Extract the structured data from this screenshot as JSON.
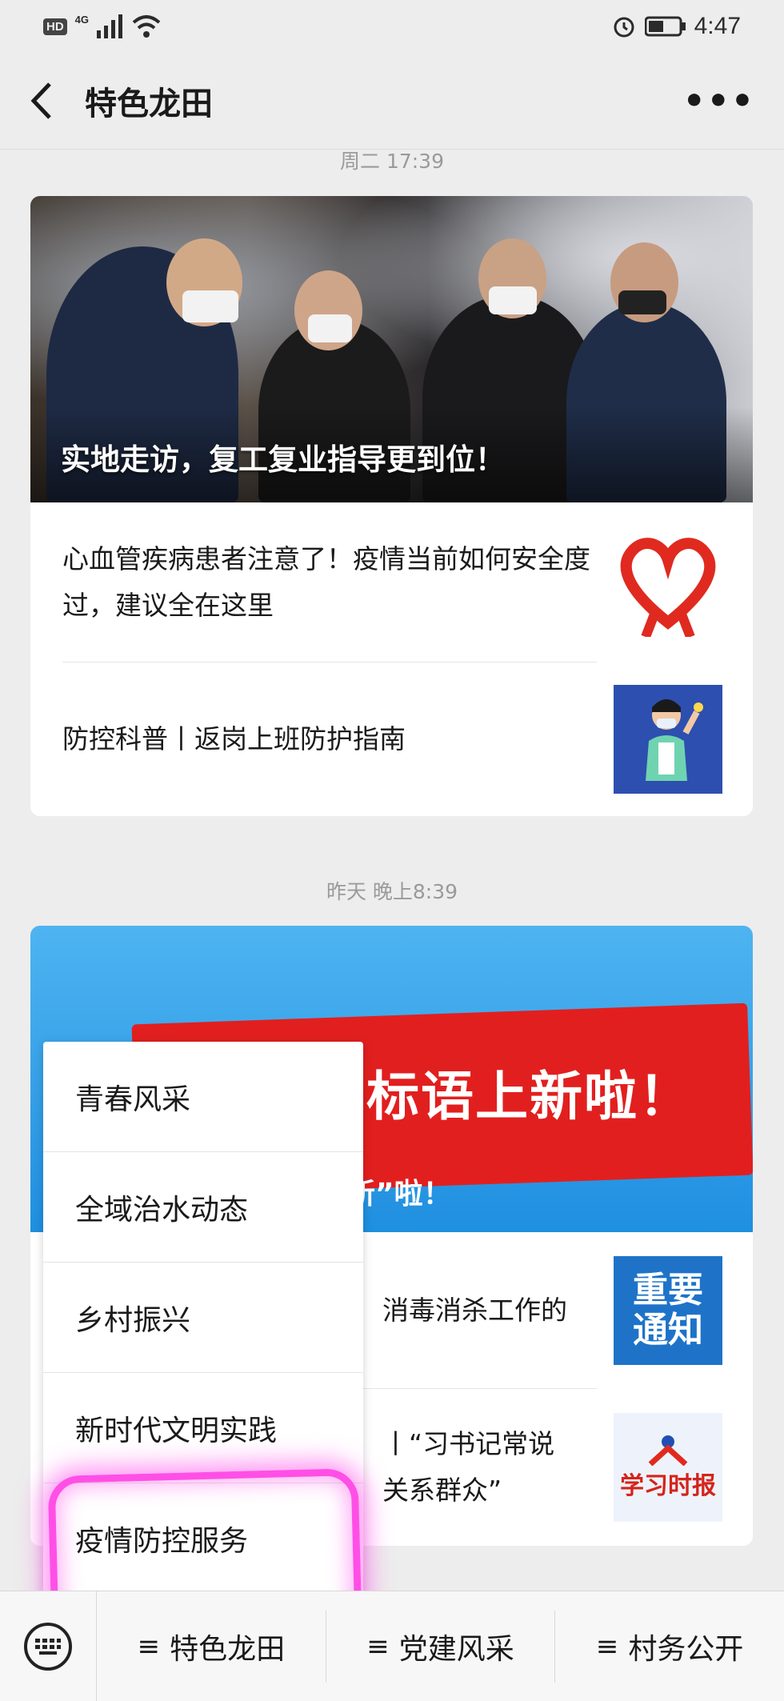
{
  "status_bar": {
    "hd_badge": "HD",
    "network": "4G",
    "time": "4:47"
  },
  "nav": {
    "title": "特色龙田",
    "more_glyph": "•••"
  },
  "feed": [
    {
      "timestamp": "周二 17:39",
      "hero_caption": "实地走访，复工复业指导更到位！",
      "articles": [
        {
          "title": "心血管疾病患者注意了！疫情当前如何安全度过，建议全在这里"
        },
        {
          "title": "防控科普丨返岗上班防护指南"
        }
      ]
    },
    {
      "timestamp": "昨天 晚上8:39",
      "banner_text": "标语上新啦！",
      "banner_caption": "新”啦！",
      "articles": [
        {
          "title": "消毒消杀工作的"
        },
        {
          "title": "丨“习书记常说",
          "title_line2": "关系群众”"
        }
      ],
      "thumb_notice": [
        "重要",
        "通知"
      ],
      "thumb_paper": "学习时报"
    }
  ],
  "popup_menu": {
    "items": [
      "青春风采",
      "全域治水动态",
      "乡村振兴",
      "新时代文明实践",
      "疫情防控服务"
    ],
    "highlighted_index": 4
  },
  "bottom_menu": {
    "tabs": [
      {
        "icon": "≡",
        "label": "特色龙田"
      },
      {
        "icon": "≡",
        "label": "党建风采"
      },
      {
        "icon": "≡",
        "label": "村务公开"
      }
    ]
  },
  "colors": {
    "background": "#ededed",
    "highlight": "#ff4fe6",
    "banner_blue": "#1f8fe0",
    "banner_red": "#e21f1f"
  }
}
